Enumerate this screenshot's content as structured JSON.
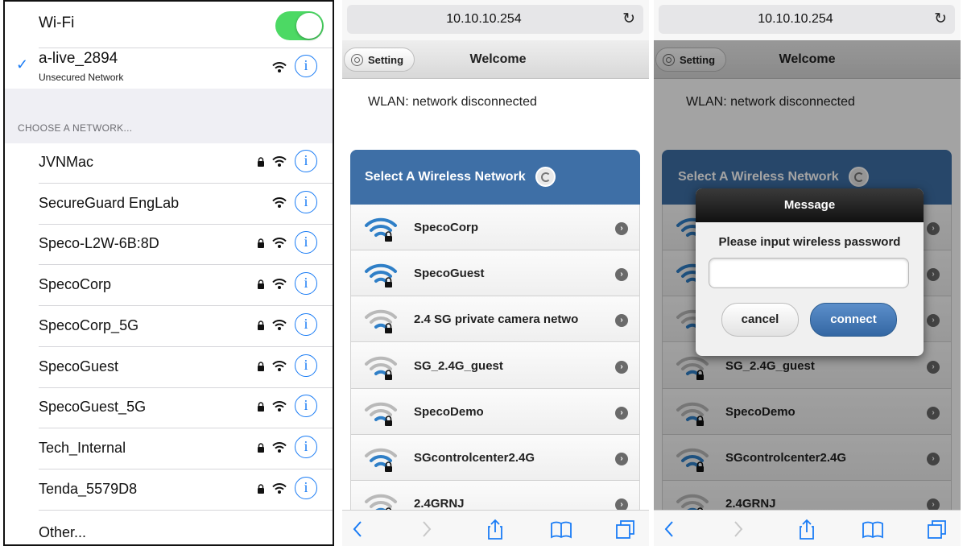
{
  "ios": {
    "wifi_label": "Wi-Fi",
    "wifi_enabled": true,
    "connected": {
      "name": "a-live_2894",
      "status": "Unsecured Network"
    },
    "choose_header": "CHOOSE A NETWORK...",
    "networks": [
      {
        "name": "JVNMac",
        "locked": true
      },
      {
        "name": "SecureGuard EngLab",
        "locked": false
      },
      {
        "name": "Speco-L2W-6B:8D",
        "locked": true
      },
      {
        "name": "SpecoCorp",
        "locked": true
      },
      {
        "name": "SpecoCorp_5G",
        "locked": true
      },
      {
        "name": "SpecoGuest",
        "locked": true
      },
      {
        "name": "SpecoGuest_5G",
        "locked": true
      },
      {
        "name": "Tech_Internal",
        "locked": true
      },
      {
        "name": "Tenda_5579D8",
        "locked": true
      }
    ],
    "other": "Other...",
    "info_glyph": "i",
    "check_glyph": "✓",
    "accent_color": "#1a7cf5",
    "toggle_color": "#4cd964"
  },
  "browser": {
    "url": "10.10.10.254",
    "reload_glyph": "↻",
    "setting_label": "Setting",
    "welcome": "Welcome",
    "status": "WLAN: network disconnected",
    "select_title": "Select A Wireless Network",
    "arrow_glyph": "›",
    "networks": [
      {
        "name": "SpecoCorp",
        "strength": "full"
      },
      {
        "name": "SpecoGuest",
        "strength": "full"
      },
      {
        "name": "2.4 SG private camera netwo",
        "strength": "weak"
      },
      {
        "name": "SG_2.4G_guest",
        "strength": "weak"
      },
      {
        "name": "SpecoDemo",
        "strength": "weak"
      },
      {
        "name": "SGcontrolcenter2.4G",
        "strength": "medium"
      },
      {
        "name": "2.4GRNJ",
        "strength": "weak"
      }
    ],
    "header_color": "#3e6fa6"
  },
  "dialog": {
    "title": "Message",
    "message": "Please input wireless password",
    "password_value": "",
    "cancel": "cancel",
    "connect": "connect"
  }
}
